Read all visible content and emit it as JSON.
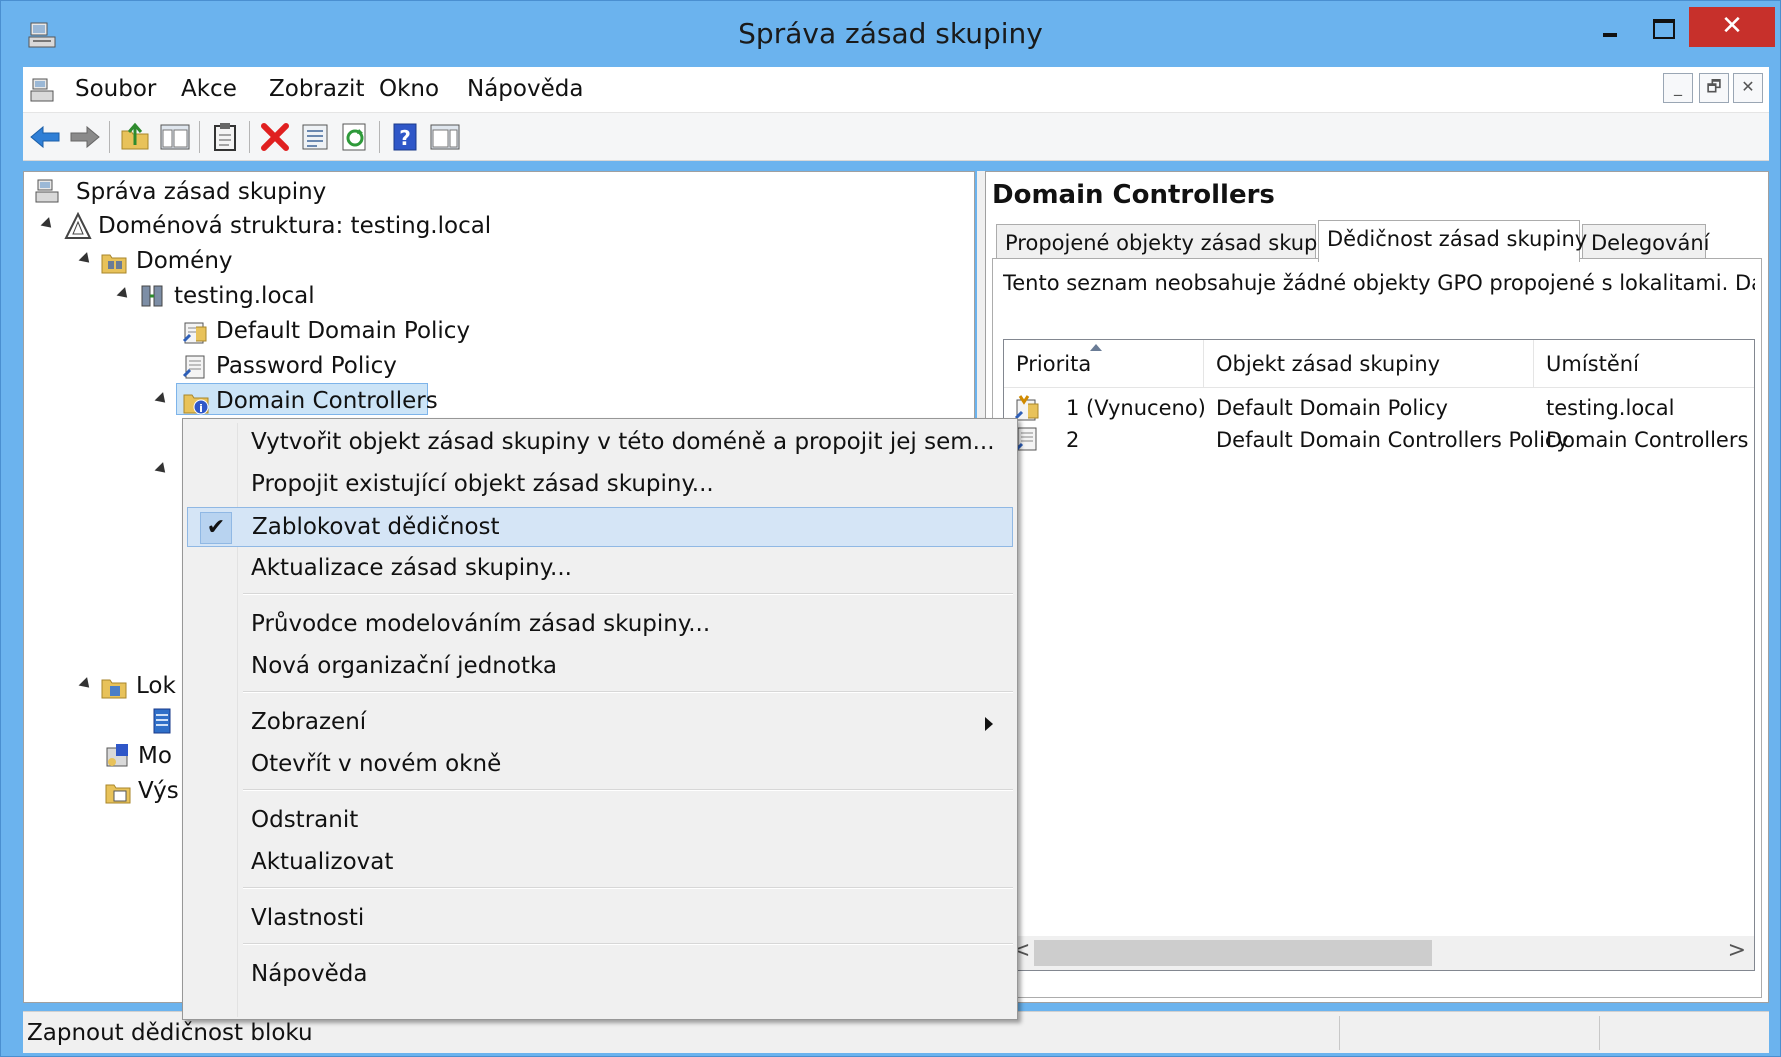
{
  "window": {
    "title": "Správa zásad skupiny",
    "close_glyph": "✕"
  },
  "menubar": {
    "items": [
      "Soubor",
      "Akce",
      "Zobrazit",
      "Okno",
      "Nápověda"
    ],
    "mdi": {
      "min": "_",
      "restore": "🗗",
      "close": "✕"
    }
  },
  "toolbar": {
    "icons": [
      "back-arrow-icon",
      "forward-arrow-icon",
      "up-folder-icon",
      "console-tree-icon",
      "clipboard-icon",
      "delete-icon",
      "properties-icon",
      "refresh-icon",
      "help-icon",
      "action-pane-icon"
    ]
  },
  "tree": {
    "root": "Správa zásad skupiny",
    "forest": "Doménová struktura: testing.local",
    "domains": "Domény",
    "domain": "testing.local",
    "gpo1": "Default Domain Policy",
    "gpo2": "Password Policy",
    "ou": "Domain Controllers",
    "sites_partial": "Lok",
    "modeling_partial": "Mo",
    "results_partial": "Výs"
  },
  "right": {
    "title": "Domain Controllers",
    "tabs": [
      "Propojené objekty zásad skupiny",
      "Dědičnost zásad skupiny",
      "Delegování"
    ],
    "info": "Tento seznam neobsahuje žádné objekty GPO propojené s lokalitami. Další info",
    "columns": [
      "Priorita",
      "Objekt zásad skupiny",
      "Umístění"
    ],
    "rows": [
      {
        "priority": "1",
        "enforced": "(Vynuceno)",
        "gpo": "Default Domain Policy",
        "location": "testing.local"
      },
      {
        "priority": "2",
        "enforced": "",
        "gpo": "Default Domain Controllers Policy",
        "location": "Domain Controllers"
      }
    ],
    "scroll_left": "<",
    "scroll_right": ">"
  },
  "context_menu": {
    "check_glyph": "✔",
    "items": [
      "Vytvořit objekt zásad skupiny v této doméně a propojit jej sem...",
      "Propojit existující objekt zásad skupiny...",
      "Zablokovat dědičnost",
      "Aktualizace zásad skupiny...",
      "Průvodce modelováním zásad skupiny...",
      "Nová organizační jednotka",
      "Zobrazení",
      "Otevřít v novém okně",
      "Odstranit",
      "Aktualizovat",
      "Vlastnosti",
      "Nápověda"
    ]
  },
  "status": {
    "text": "Zapnout dědičnost bloku"
  }
}
